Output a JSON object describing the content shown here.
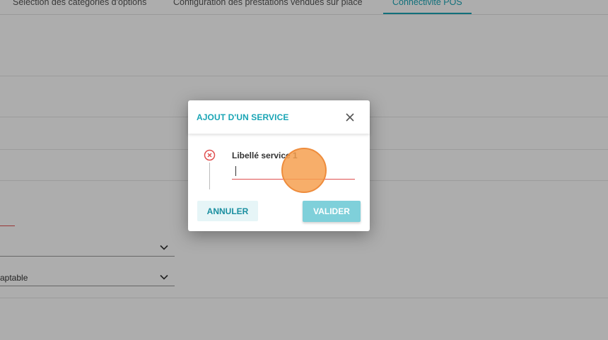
{
  "tabs": [
    {
      "label": "Sélection des catégories d'options"
    },
    {
      "label": "Configuration des prestations vendues sur place"
    },
    {
      "label": "Connectivité POS"
    }
  ],
  "background": {
    "select_1_value": "",
    "select_2_value": "aptable"
  },
  "dialog": {
    "title": "AJOUT D'UN SERVICE",
    "field_label": "Libellé service 1",
    "field_value": "",
    "cancel_label": "ANNULER",
    "validate_label": "VALIDER",
    "icons": {
      "close": "close-icon",
      "step_error": "error-circle-icon",
      "chevron": "chevron-down-icon"
    }
  },
  "colors": {
    "accent": "#1aa5b5",
    "error": "#e05050",
    "validate_bg": "#7fd0da",
    "cancel_bg": "#e6f5f7",
    "click_marker": "#f6a050"
  }
}
